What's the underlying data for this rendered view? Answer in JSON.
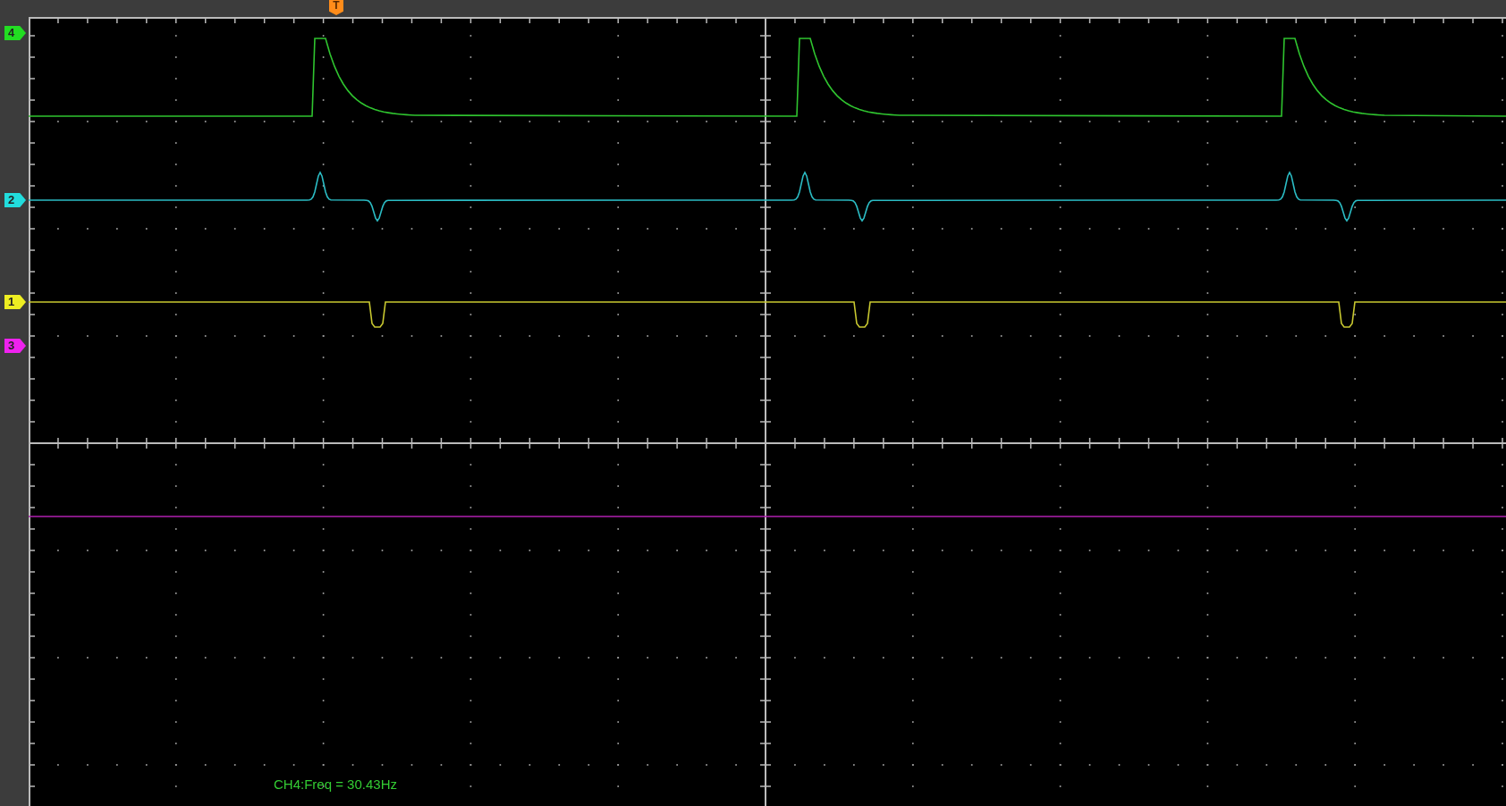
{
  "trigger_marker": {
    "label": "T"
  },
  "channels": [
    {
      "label": "4",
      "color": "#22dd22",
      "kind": "pulse"
    },
    {
      "label": "2",
      "color": "#22dddd",
      "kind": "bipolar"
    },
    {
      "label": "1",
      "color": "#eeee22",
      "kind": "dip"
    },
    {
      "label": "3",
      "color": "#ee22ee",
      "kind": "flat"
    }
  ],
  "measurement": "CH4:Freq = 30.43Hz"
}
